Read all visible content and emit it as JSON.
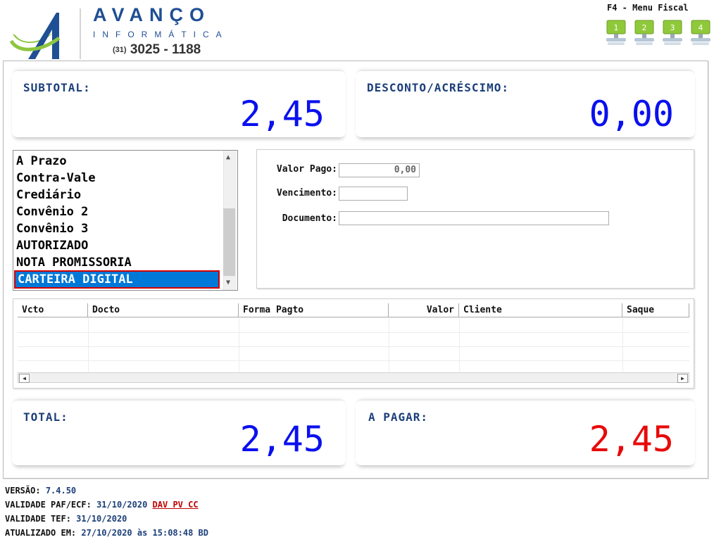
{
  "header": {
    "brand_name": "AVANÇO",
    "brand_sub": "INFORMÁTICA",
    "phone_ddd": "(31)",
    "phone_number": "3025 - 1188",
    "menu_fiscal": "F4 - Menu Fiscal",
    "fiscal_buttons": [
      "1",
      "2",
      "3",
      "4"
    ]
  },
  "summary": {
    "subtotal_label": "SUBTOTAL:",
    "subtotal_value": "2,45",
    "desconto_label": "DESCONTO/ACRÉSCIMO:",
    "desconto_value": "0,00",
    "total_label": "TOTAL:",
    "total_value": "2,45",
    "apagar_label": "A PAGAR:",
    "apagar_value": "2,45"
  },
  "payment_methods": {
    "items": [
      "A Prazo",
      "Contra-Vale",
      "Crediário",
      "Convênio 2",
      "Convênio 3",
      "AUTORIZADO",
      "NOTA PROMISSORIA",
      "CARTEIRA DIGITAL"
    ],
    "selected": "CARTEIRA DIGITAL"
  },
  "form": {
    "valor_pago_label": "Valor Pago:",
    "valor_pago_value": "0,00",
    "vencimento_label": "Vencimento:",
    "vencimento_value": "",
    "documento_label": "Documento:",
    "documento_value": ""
  },
  "grid": {
    "columns": [
      "Vcto",
      "Docto",
      "Forma Pagto",
      "Valor",
      "Cliente",
      "Saque"
    ]
  },
  "footer": {
    "versao_label": "VERSÃO:",
    "versao_value": "7.4.50",
    "validade_paf_label": "VALIDADE PAF/ECF:",
    "validade_paf_value": "31/10/2020",
    "dav_link": "DAV PV CC",
    "validade_tef_label": "VALIDADE TEF:",
    "validade_tef_value": "31/10/2020",
    "atualizado_label": "ATUALIZADO EM:",
    "atualizado_value": "27/10/2020 às 15:08:48 BD"
  },
  "colors": {
    "brand": "#1f4f94",
    "value_blue": "#0a10ee",
    "value_red": "#e80a0a",
    "selection": "#0078d7",
    "fiscal_green": "#8fc93a"
  }
}
